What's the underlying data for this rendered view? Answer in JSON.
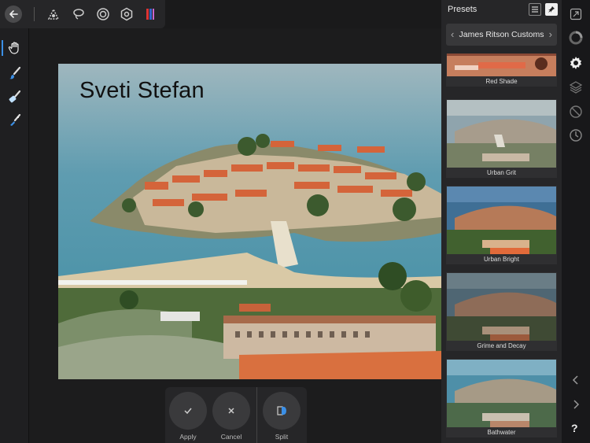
{
  "toolbar": {
    "icons": [
      "back-arrow-icon",
      "selection-brush-icon",
      "lasso-icon",
      "spiral-icon",
      "gear-hex-icon",
      "lut-icon"
    ]
  },
  "left_tools": [
    "hand-icon",
    "paint-brush-icon",
    "eraser-brush-icon",
    "clone-brush-icon"
  ],
  "canvas": {
    "title_text": "Sveti Stefan"
  },
  "actions": {
    "apply": "Apply",
    "cancel": "Cancel",
    "split": "Split"
  },
  "presets": {
    "title": "Presets",
    "category": "James Ritson Customs",
    "items": [
      {
        "label": "Red Shade"
      },
      {
        "label": "Urban Grit"
      },
      {
        "label": "Urban Bright"
      },
      {
        "label": "Grime and Decay"
      },
      {
        "label": "Bathwater"
      }
    ]
  },
  "rail": {
    "help": "?"
  },
  "colors": {
    "accent": "#3b8fe6",
    "panel": "#262628",
    "background": "#1a1a1b"
  }
}
